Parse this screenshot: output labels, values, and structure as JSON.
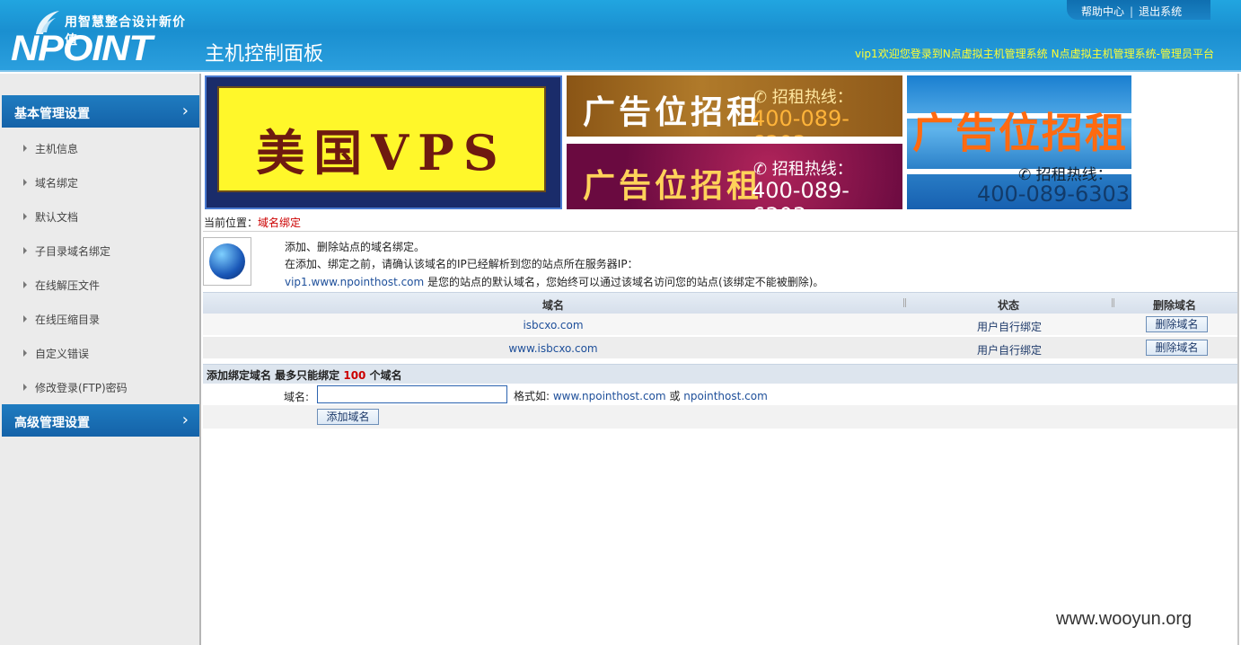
{
  "header": {
    "slogan": "用智慧整合设计新价值",
    "brand": "NPOINT",
    "panel_title": "主机控制面板",
    "top_links": [
      "帮助中心",
      "退出系统"
    ],
    "welcome_user": "vip1欢迎您登录到N点虚拟主机管理系统",
    "welcome_platform": "N点虚拟主机管理系统-管理员平台"
  },
  "sidebar": {
    "sections": [
      {
        "label": "基本管理设置",
        "items": [
          "主机信息",
          "域名绑定",
          "默认文档",
          "子目录域名绑定",
          "在线解压文件",
          "在线压缩目录",
          "自定义错误",
          "修改登录(FTP)密码"
        ]
      },
      {
        "label": "高级管理设置",
        "items": []
      }
    ]
  },
  "banners": {
    "vps": "美国VPS",
    "ad_title": "广告位招租",
    "ad_hotline": "✆ 招租热线：",
    "ad_phone": "400-089-6303"
  },
  "breadcrumb": {
    "prefix": "当前位置：",
    "current": "域名绑定"
  },
  "info": {
    "line1": "添加、删除站点的域名绑定。",
    "line2": "在添加、绑定之前，请确认该域名的IP已经解析到您的站点所在服务器IP：",
    "default_domain": "vip1.www.npointhost.com",
    "line3": " 是您的站点的默认域名，您始终可以通过该域名访问您的站点(该绑定不能被删除)。"
  },
  "table": {
    "headers": [
      "域名",
      "状态",
      "删除域名"
    ],
    "rows": [
      {
        "domain": "isbcxo.com",
        "status": "用户自行绑定",
        "action": "删除域名"
      },
      {
        "domain": "www.isbcxo.com",
        "status": "用户自行绑定",
        "action": "删除域名"
      }
    ]
  },
  "add": {
    "heading_prefix": "添加绑定域名 最多只能绑定 ",
    "limit": "100",
    "heading_suffix": " 个域名",
    "field_label": "域名:",
    "field_value": "",
    "hint_prefix": "格式如: ",
    "hint_ex1": "www.npointhost.com",
    "hint_or": " 或 ",
    "hint_ex2": "npointhost.com",
    "button": "添加域名"
  },
  "watermark": "www.wooyun.org"
}
